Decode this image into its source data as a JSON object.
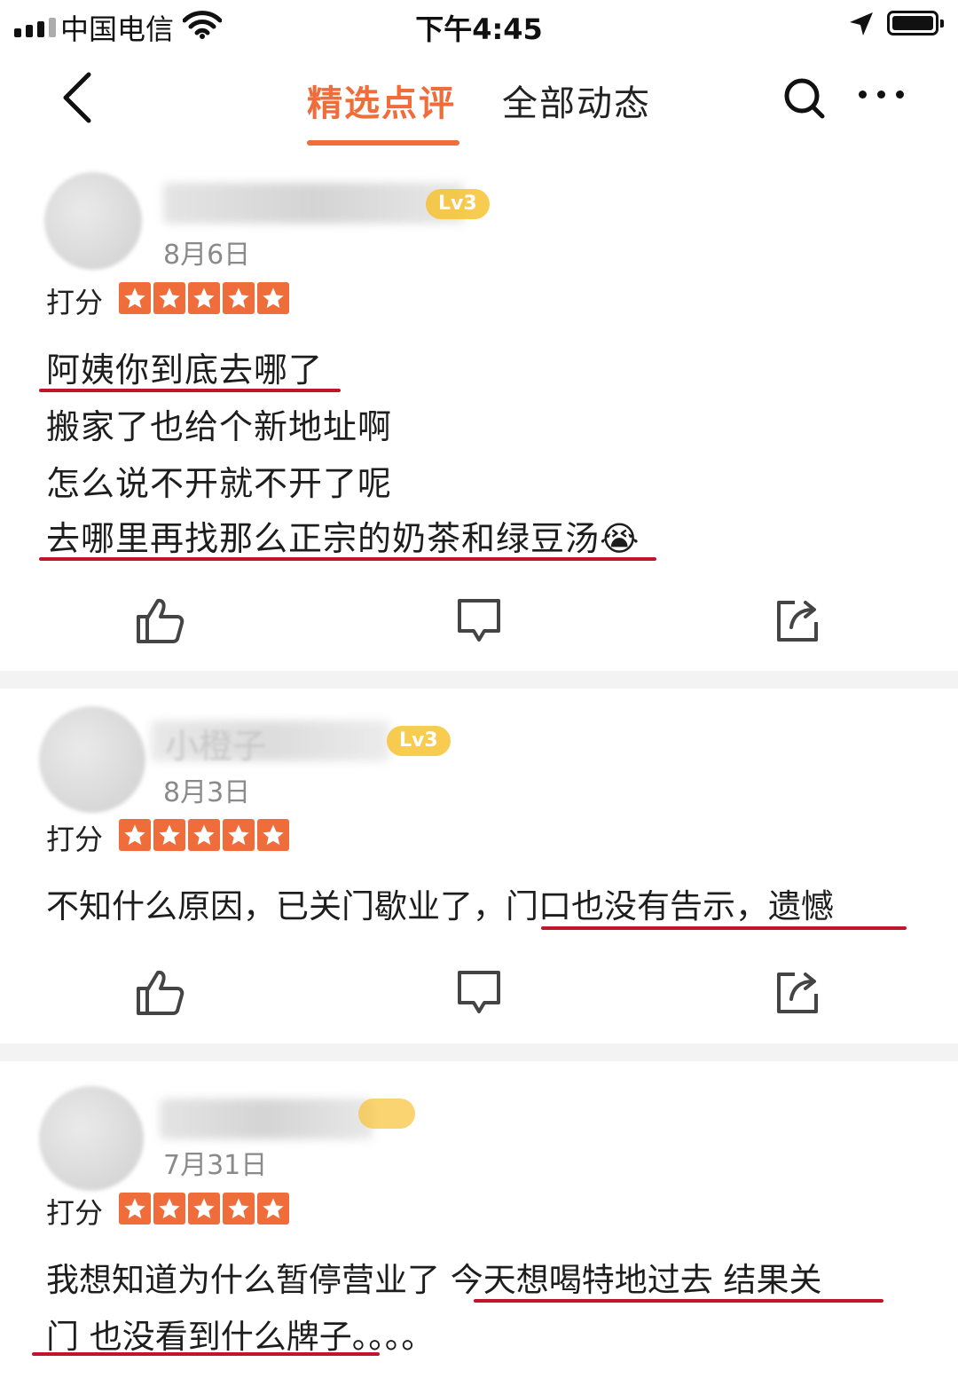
{
  "status_bar": {
    "carrier": "中国电信",
    "time": "下午4:45"
  },
  "nav": {
    "tabs": [
      {
        "label": "精选点评",
        "active": true
      },
      {
        "label": "全部动态",
        "active": false
      }
    ]
  },
  "colors": {
    "accent": "#ef6c3b",
    "underline_red": "#c0152a",
    "level_badge": "#f7c233"
  },
  "reviews": [
    {
      "name": "",
      "level": "Lv3",
      "date": "8月6日",
      "score_label": "打分",
      "stars": 5,
      "lines": [
        "阿姨你到底去哪了",
        "搬家了也给个新地址啊",
        "怎么说不开就不开了呢",
        "去哪里再找那么正宗的奶茶和绿豆汤😭"
      ]
    },
    {
      "name": "小橙子",
      "level": "Lv3",
      "date": "8月3日",
      "score_label": "打分",
      "stars": 5,
      "lines": [
        "不知什么原因，已关门歇业了，门口也没有告示，遗憾"
      ]
    },
    {
      "name": "",
      "level": "",
      "date": "7月31日",
      "score_label": "打分",
      "stars": 5,
      "lines": [
        "我想知道为什么暂停营业了 今天想喝特地过去 结果关",
        "门 也没看到什么牌子。。。。"
      ]
    }
  ]
}
